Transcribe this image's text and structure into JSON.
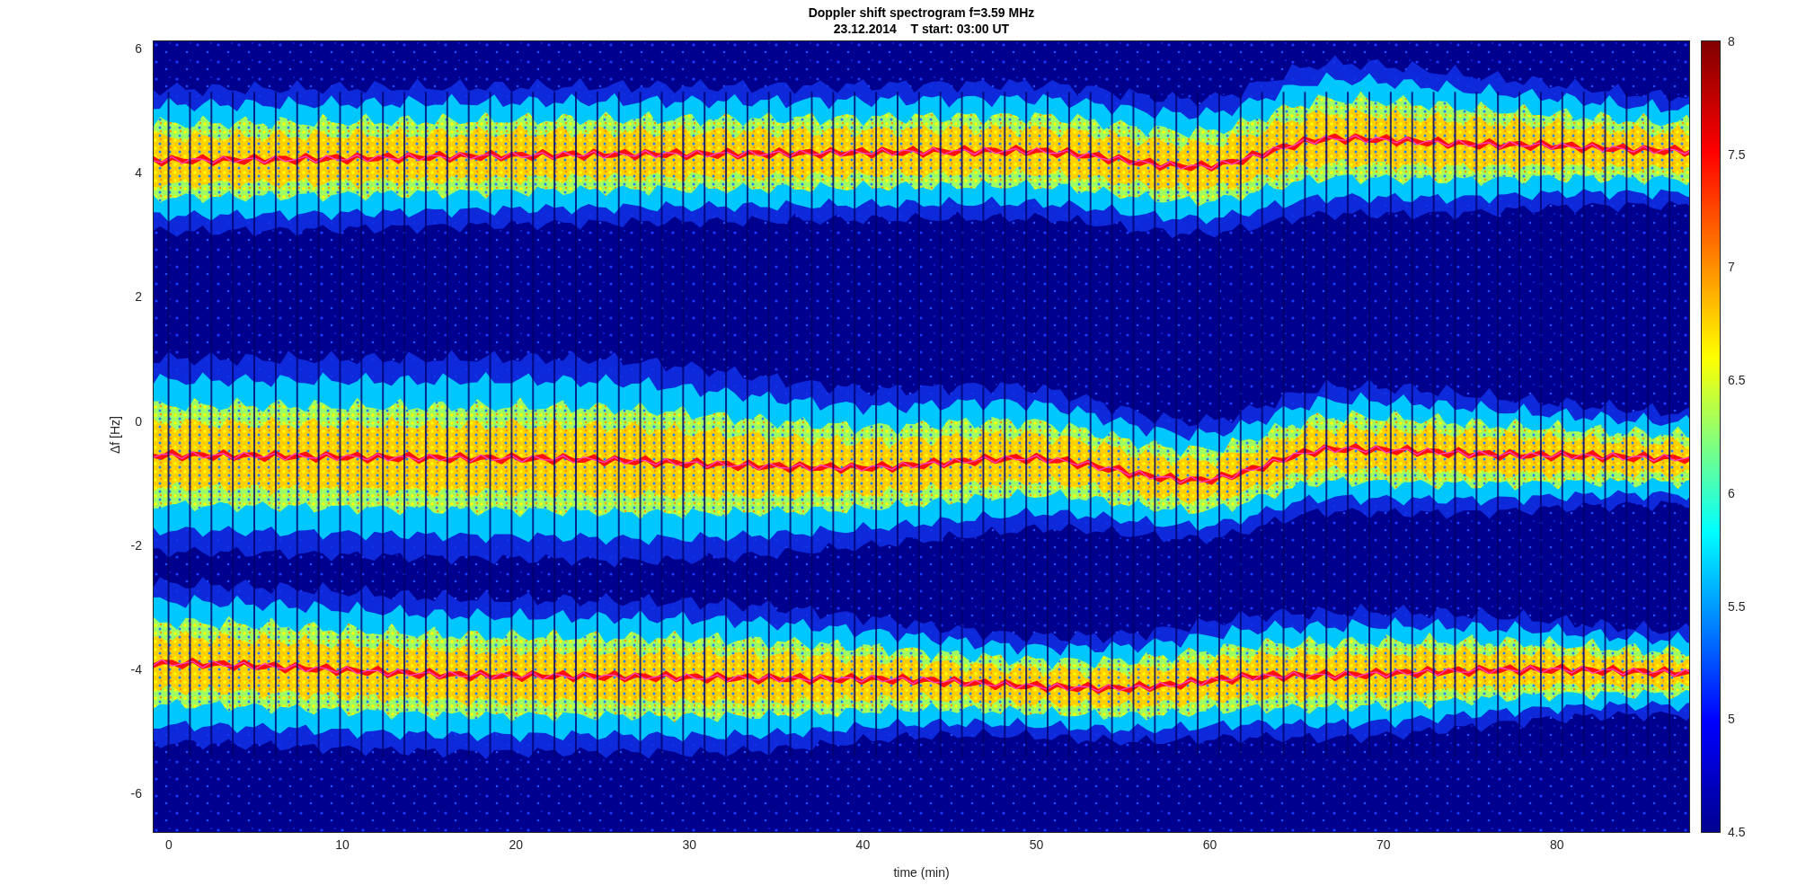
{
  "figure": {
    "title": "Doppler shift spectrogram f=3.59 MHz",
    "subtitle": "23.12.2014    T start: 03:00 UT"
  },
  "axes": {
    "xlabel": "time (min)",
    "ylabel": "Δf [Hz]",
    "xticks": [
      "0",
      "10",
      "20",
      "30",
      "40",
      "50",
      "60",
      "70",
      "80"
    ],
    "yticks": [
      "6",
      "4",
      "2",
      "0",
      "-2",
      "-4",
      "-6"
    ]
  },
  "colorbar": {
    "ticks": [
      "8",
      "7.5",
      "7",
      "6.5",
      "6",
      "5.5",
      "5",
      "4.5"
    ]
  }
}
